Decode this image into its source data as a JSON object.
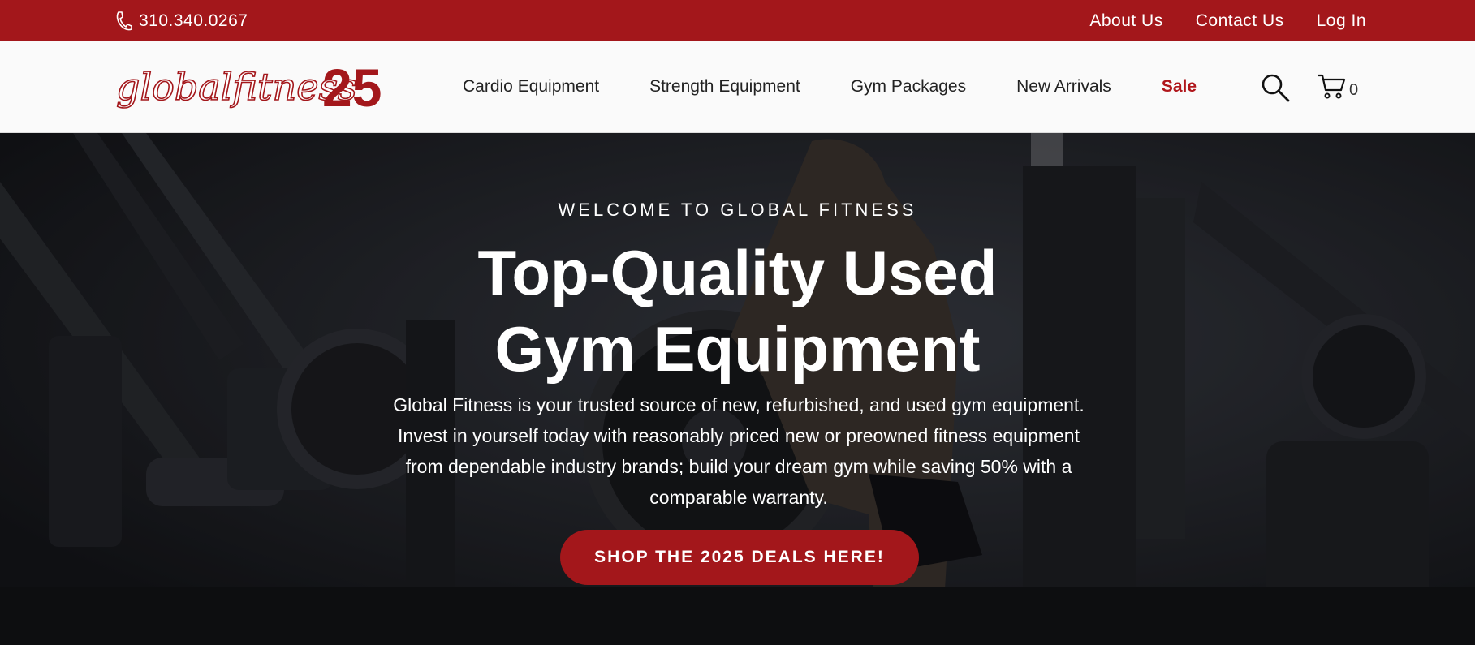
{
  "topbar": {
    "phone": "310.340.0267",
    "links": [
      "About Us",
      "Contact Us",
      "Log In"
    ]
  },
  "nav": {
    "logo_text": "globalfitness",
    "logo_number": "25",
    "menu": [
      "Cardio Equipment",
      "Strength Equipment",
      "Gym Packages",
      "New Arrivals",
      "Sale"
    ],
    "cart_count": "0",
    "icons": [
      "phone-icon",
      "search-icon",
      "cart-icon"
    ]
  },
  "hero": {
    "eyebrow": "WELCOME TO GLOBAL FITNESS",
    "headline_line1": "Top-Quality Used",
    "headline_line2": "Gym Equipment",
    "description": "Global Fitness is your trusted source of new, refurbished, and used gym equipment. Invest in yourself today with reasonably priced new or preowned fitness equipment from dependable industry brands; build your dream gym while saving 50% with a comparable warranty.",
    "cta": "SHOP THE 2025 DEALS HERE!"
  },
  "colors": {
    "brand_red": "#a3171b",
    "sale_red": "#b0161b",
    "nav_bg": "#fafafa"
  }
}
